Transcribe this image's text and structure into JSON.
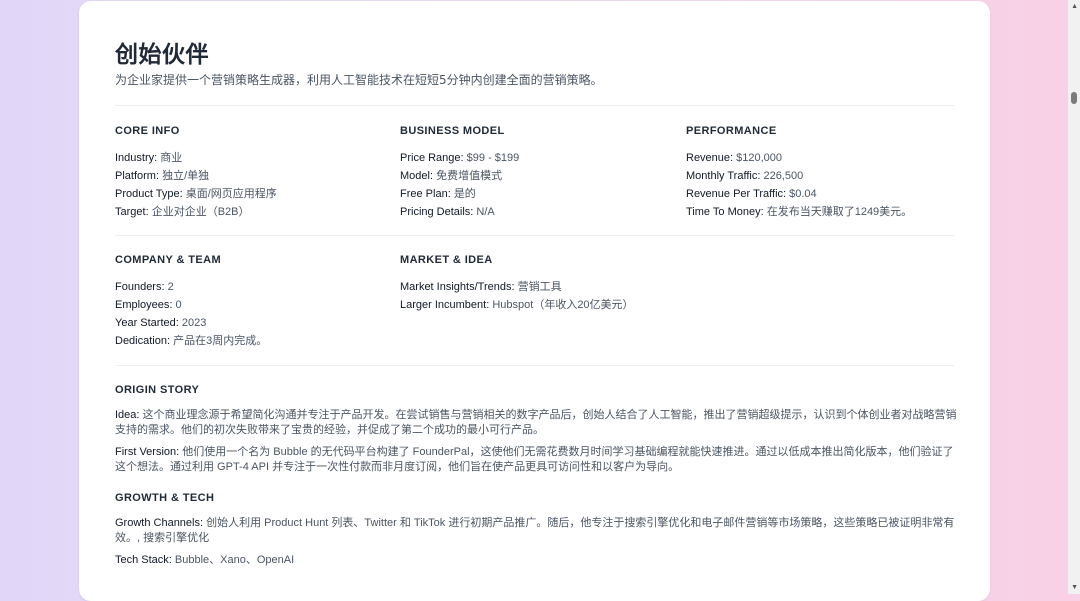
{
  "title": "创始伙伴",
  "subtitle": "为企业家提供一个营销策略生成器，利用人工智能技术在短短5分钟内创建全面的营销策略。",
  "core_info": {
    "heading": "CORE INFO",
    "rows": [
      {
        "k": "Industry:",
        "v": "商业"
      },
      {
        "k": "Platform:",
        "v": "独立/单独"
      },
      {
        "k": "Product Type:",
        "v": "桌面/网页应用程序"
      },
      {
        "k": "Target:",
        "v": "企业对企业（B2B）"
      }
    ]
  },
  "business_model": {
    "heading": "BUSINESS MODEL",
    "rows": [
      {
        "k": "Price Range:",
        "v": "$99 - $199"
      },
      {
        "k": "Model:",
        "v": "免费增值模式"
      },
      {
        "k": "Free Plan:",
        "v": "是的"
      },
      {
        "k": "Pricing Details:",
        "v": "N/A"
      }
    ]
  },
  "performance": {
    "heading": "PERFORMANCE",
    "rows": [
      {
        "k": "Revenue:",
        "v": "$120,000"
      },
      {
        "k": "Monthly Traffic:",
        "v": "226,500"
      },
      {
        "k": "Revenue Per Traffic:",
        "v": "$0.04"
      },
      {
        "k": "Time To Money:",
        "v": "在发布当天赚取了1249美元。"
      }
    ]
  },
  "company_team": {
    "heading": "COMPANY & TEAM",
    "rows": [
      {
        "k": "Founders:",
        "v": "2"
      },
      {
        "k": "Employees:",
        "v": "0"
      },
      {
        "k": "Year Started:",
        "v": "2023"
      },
      {
        "k": "Dedication:",
        "v": "产品在3周内完成。"
      }
    ]
  },
  "market_idea": {
    "heading": "MARKET & IDEA",
    "rows": [
      {
        "k": "Market Insights/Trends:",
        "v": "营销工具"
      },
      {
        "k": "Larger Incumbent:",
        "v": "Hubspot（年收入20亿美元）"
      }
    ]
  },
  "origin_story": {
    "heading": "ORIGIN STORY",
    "idea_k": "Idea:",
    "idea_v": "这个商业理念源于希望简化沟通并专注于产品开发。在尝试销售与营销相关的数字产品后，创始人结合了人工智能，推出了营销超级提示，认识到个体创业者对战略营销支持的需求。他们的初次失败带来了宝贵的经验，并促成了第二个成功的最小可行产品。",
    "first_k": "First Version:",
    "first_v": "他们使用一个名为 Bubble 的无代码平台构建了 FounderPal，这使他们无需花费数月时间学习基础编程就能快速推进。通过以低成本推出简化版本，他们验证了这个想法。通过利用 GPT-4 API 并专注于一次性付款而非月度订阅，他们旨在使产品更具可访问性和以客户为导向。"
  },
  "growth_tech": {
    "heading": "GROWTH & TECH",
    "growth_k": "Growth Channels:",
    "growth_v": "创始人利用 Product Hunt 列表、Twitter 和 TikTok 进行初期产品推广。随后，他专注于搜索引擎优化和电子邮件营销等市场策略，这些策略已被证明非常有效。, 搜索引擎优化",
    "tech_k": "Tech Stack:",
    "tech_v": "Bubble、Xano、OpenAI"
  }
}
